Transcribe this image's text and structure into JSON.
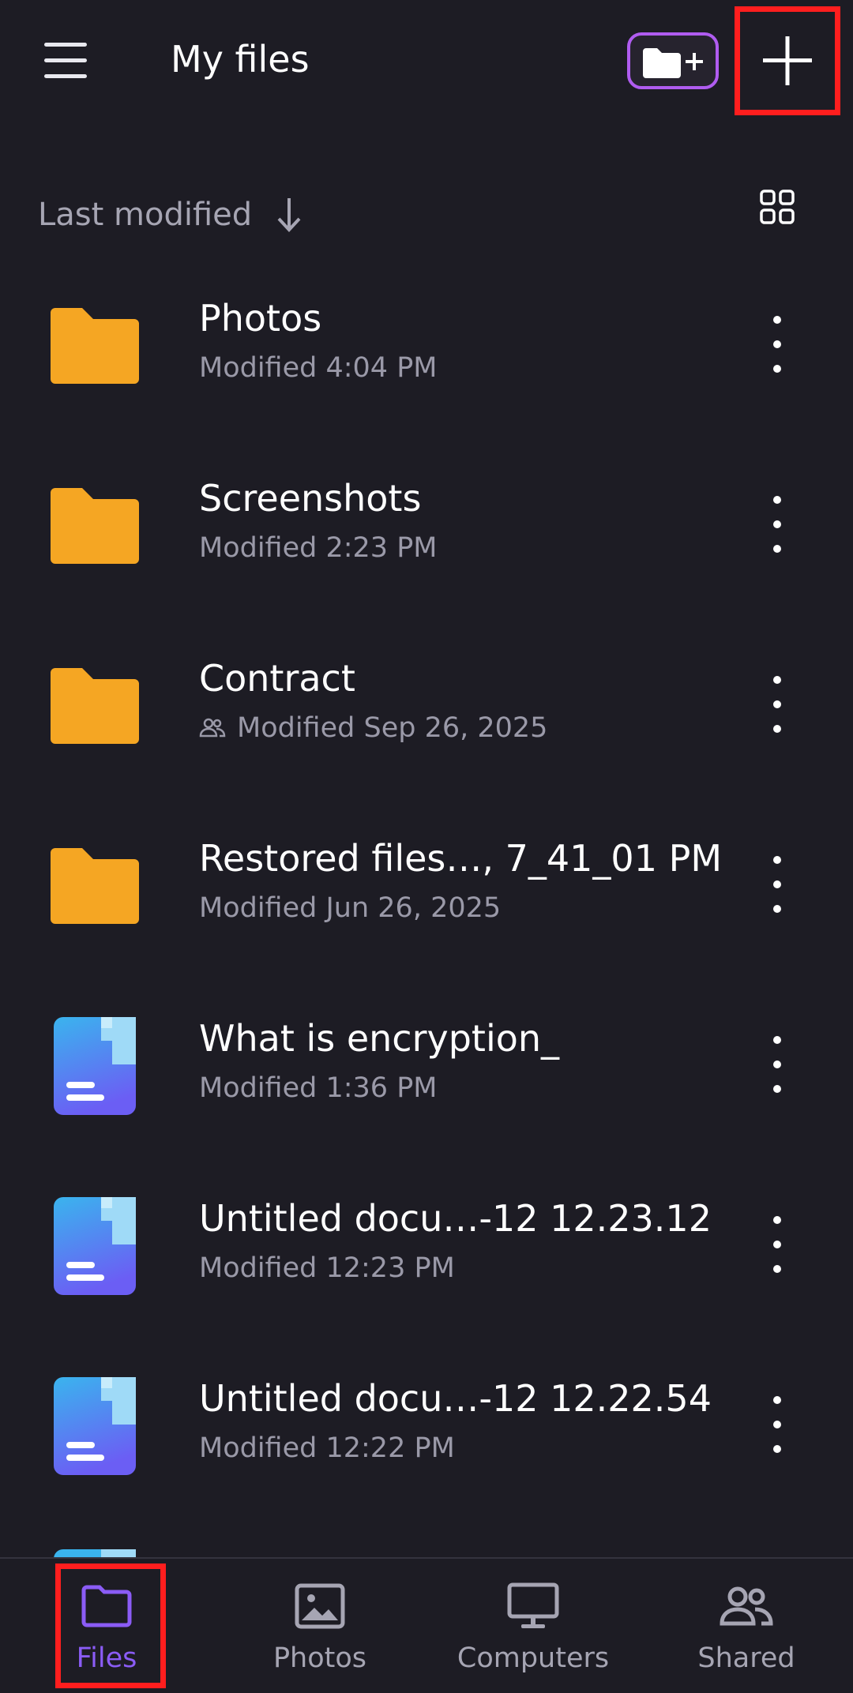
{
  "header": {
    "title": "My files",
    "new_folder_icon": "folder-plus-icon",
    "add_icon": "plus-icon",
    "menu_icon": "hamburger-menu-icon"
  },
  "sort": {
    "label": "Last modified",
    "direction_icon": "arrow-down-icon",
    "view_icon": "grid-view-icon"
  },
  "files": [
    {
      "name": "Photos",
      "meta": "Modified 4:04 PM",
      "type": "folder",
      "shared": false
    },
    {
      "name": "Screenshots",
      "meta": "Modified 2:23 PM",
      "type": "folder",
      "shared": false
    },
    {
      "name": "Contract",
      "meta": "Modified Sep 26, 2025",
      "type": "folder",
      "shared": true
    },
    {
      "name": "Restored files…, 7_41_01 PM",
      "meta": "Modified Jun 26, 2025",
      "type": "folder",
      "shared": false
    },
    {
      "name": "What is encryption_",
      "meta": "Modified 1:36 PM",
      "type": "document",
      "shared": false
    },
    {
      "name": "Untitled docu…-12 12.23.12",
      "meta": "Modified 12:23 PM",
      "type": "document",
      "shared": false
    },
    {
      "name": "Untitled docu…-12 12.22.54",
      "meta": "Modified 12:22 PM",
      "type": "document",
      "shared": false
    }
  ],
  "nav": {
    "items": [
      {
        "label": "Files",
        "icon": "folder-icon",
        "active": true
      },
      {
        "label": "Photos",
        "icon": "image-icon",
        "active": false
      },
      {
        "label": "Computers",
        "icon": "monitor-icon",
        "active": false
      },
      {
        "label": "Shared",
        "icon": "people-icon",
        "active": false
      }
    ]
  },
  "colors": {
    "background": "#1d1c24",
    "folder": "#f5a623",
    "accent": "#8b5cf6",
    "highlight": "#ff1e1e",
    "new_folder_border": "#b05cf0"
  }
}
